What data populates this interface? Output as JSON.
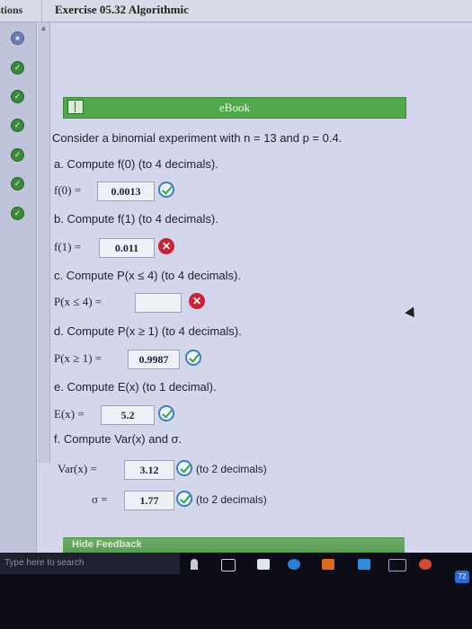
{
  "header": {
    "left_tab": "stions",
    "title": "Exercise 05.32 Algorithmic"
  },
  "ebook": {
    "label": "eBook"
  },
  "problem": {
    "intro": "Consider a binomial experiment with n = 13 and p = 0.4.",
    "a": {
      "prompt": "a. Compute f(0) (to 4 decimals).",
      "label": "f(0) =",
      "value": "0.0013"
    },
    "b": {
      "prompt": "b. Compute f(1) (to 4 decimals).",
      "label": "f(1) =",
      "value": "0.011"
    },
    "c": {
      "prompt": "c. Compute P(x ≤ 4) (to 4 decimals).",
      "label": "P(x ≤ 4) =",
      "value": ""
    },
    "d": {
      "prompt": "d. Compute P(x ≥ 1) (to 4 decimals).",
      "label": "P(x ≥ 1) =",
      "value": "0.9987"
    },
    "e": {
      "prompt": "e. Compute E(x) (to 1 decimal).",
      "label": "E(x) =",
      "value": "5.2"
    },
    "f": {
      "prompt": "f. Compute Var(x) and σ.",
      "var_label": "Var(x) =",
      "var_value": "3.12",
      "var_note": "(to 2 decimals)",
      "sigma_label": "σ =",
      "sigma_value": "1.77",
      "sigma_note": "(to 2 decimals)"
    }
  },
  "feedback": {
    "label": "Hide Feedback"
  },
  "taskbar": {
    "search_placeholder": "Type here to search",
    "badge": "72"
  },
  "colors": {
    "correct": "#3aa348",
    "incorrect": "#c7233a",
    "ebook_green": "#52a84c"
  }
}
